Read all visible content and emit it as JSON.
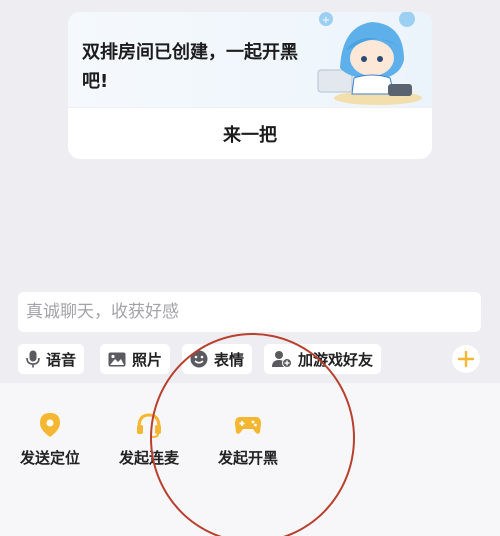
{
  "card": {
    "title": "双排房间已创建，一起开黑吧!",
    "action_label": "来一把"
  },
  "composer": {
    "placeholder": "真诚聊天，收获好感"
  },
  "toolbar": {
    "chips": [
      {
        "label": "语音",
        "icon": "microphone-icon"
      },
      {
        "label": "照片",
        "icon": "image-icon"
      },
      {
        "label": "表情",
        "icon": "emoji-icon"
      },
      {
        "label": "加游戏好友",
        "icon": "add-friend-icon"
      }
    ],
    "more_icon": "plus-icon"
  },
  "panel": {
    "items": [
      {
        "label": "发送定位",
        "icon": "location-icon"
      },
      {
        "label": "发起连麦",
        "icon": "headset-icon"
      },
      {
        "label": "发起开黑",
        "icon": "gamepad-icon"
      }
    ]
  },
  "colors": {
    "accent": "#f5b731",
    "annotation": "#b8402e",
    "icon_gray": "#5a5a5f"
  }
}
